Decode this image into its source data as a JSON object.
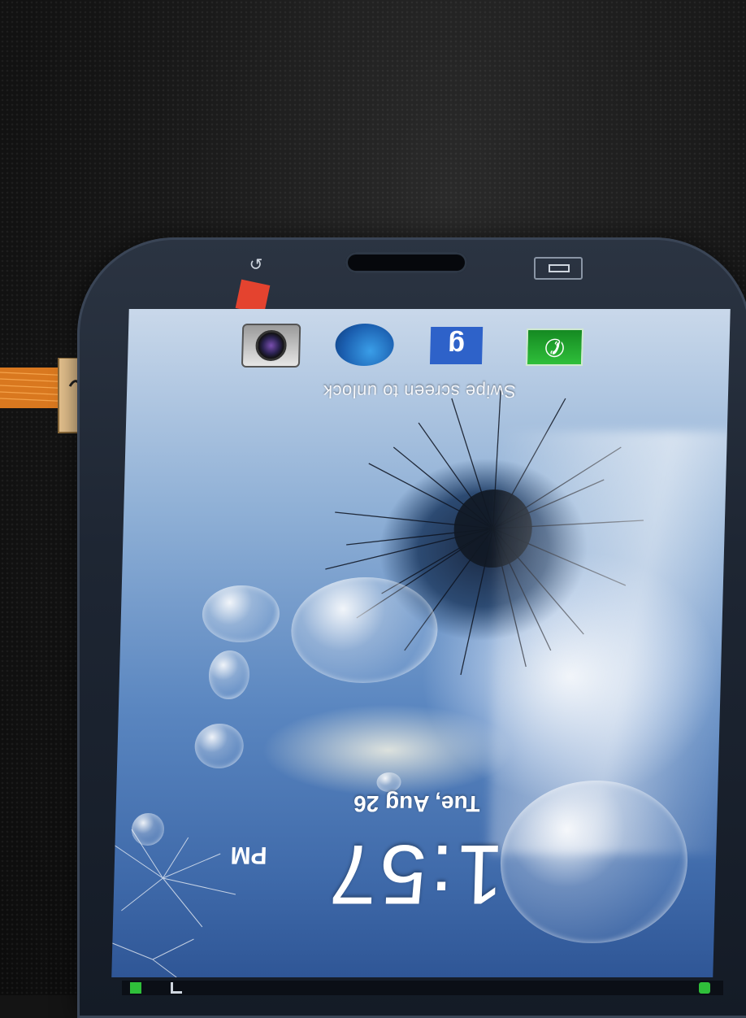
{
  "lock_screen": {
    "shortcuts": [
      {
        "name": "camera-icon"
      },
      {
        "name": "internet-globe-icon"
      },
      {
        "name": "google-icon",
        "glyph": "g"
      },
      {
        "name": "phone-icon",
        "glyph": "✆"
      }
    ],
    "swipe_hint": "Swipe screen to unlock",
    "date": "Tue, Aug 26",
    "time": "1:57",
    "ampm": "PM"
  },
  "colors": {
    "wallpaper_blue": "#5a86c0",
    "phone_bezel": "#1e2633",
    "sticker": "#e4432f",
    "cable": "#d9781f",
    "phone_icon_green": "#2fbf3a",
    "google_icon_blue": "#2e62c9"
  }
}
